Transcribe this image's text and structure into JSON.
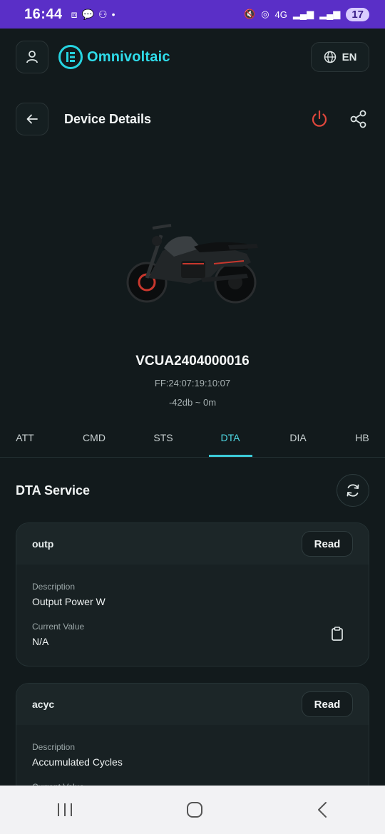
{
  "status_bar": {
    "time": "16:44",
    "network": "4G",
    "battery": "17"
  },
  "app_header": {
    "brand": "Omnivoltaic",
    "language": "EN"
  },
  "page": {
    "title": "Device Details"
  },
  "device": {
    "id": "VCUA2404000016",
    "mac": "FF:24:07:19:10:07",
    "signal": "-42db ~ 0m"
  },
  "tabs": [
    {
      "label": "ATT"
    },
    {
      "label": "CMD"
    },
    {
      "label": "STS"
    },
    {
      "label": "DTA",
      "active": true
    },
    {
      "label": "DIA"
    },
    {
      "label": "HB"
    }
  ],
  "service": {
    "title": "DTA Service"
  },
  "characteristics": [
    {
      "name": "outp",
      "read_label": "Read",
      "description_label": "Description",
      "description": "Output Power W",
      "current_value_label": "Current Value",
      "current_value": "N/A"
    },
    {
      "name": "acyc",
      "read_label": "Read",
      "description_label": "Description",
      "description": "Accumulated Cycles",
      "current_value_label": "Current Value"
    }
  ],
  "colors": {
    "accent": "#3ccbd8",
    "power": "#e0473c",
    "status_bar": "#5a2fc7",
    "background": "#121a1c"
  },
  "icons": [
    "user-icon",
    "globe-icon",
    "back-arrow-icon",
    "power-icon",
    "share-icon",
    "refresh-icon",
    "clipboard-icon"
  ]
}
